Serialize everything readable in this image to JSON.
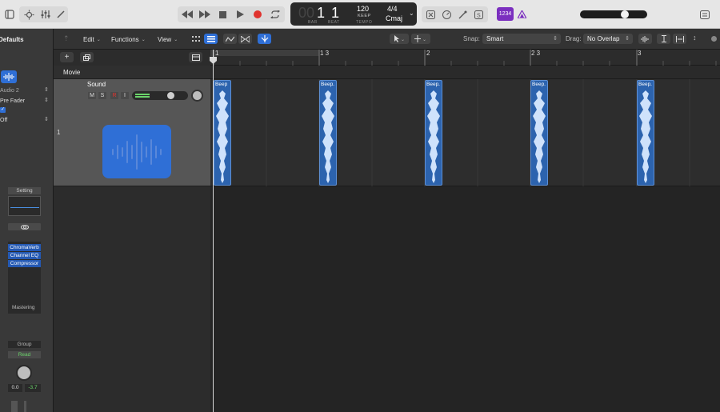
{
  "toolbar": {
    "lcd": {
      "bar": "1",
      "beat": "1",
      "bar_label": "BAR",
      "beat_label": "BEAT",
      "tempo": "120",
      "tempo_mode": "KEEP",
      "tempo_label": "TEMPO",
      "signature": "4/4",
      "key": "Cmaj"
    },
    "counter_badge": "1234"
  },
  "inspector": {
    "title": "Defaults",
    "output": "Audio 2",
    "send_position": "Pre Fader",
    "automation_mode": "Off",
    "setting_label": "Setting",
    "plugins": [
      "ChromaVerb",
      "Channel EQ",
      "Compressor"
    ],
    "mastering_label": "Mastering",
    "group_label": "Group",
    "read_label": "Read",
    "pan_value": "0.0",
    "volume_value": "-3.7"
  },
  "trackbar": {
    "edit_label": "Edit",
    "functions_label": "Functions",
    "view_label": "View",
    "snap_label": "Snap:",
    "snap_value": "Smart",
    "drag_label": "Drag:",
    "drag_value": "No Overlap"
  },
  "tracks": {
    "movie_label": "Movie",
    "track1": {
      "number": "1",
      "name": "Sound",
      "mute": "M",
      "solo": "S",
      "record": "R",
      "input": "I"
    }
  },
  "ruler": {
    "labels": [
      "1",
      "1 3",
      "2",
      "2 3",
      "3"
    ]
  },
  "regions": [
    "Beep",
    "Beep.",
    "Beep.",
    "Beep.",
    "Beep."
  ],
  "colors": {
    "region_fill": "#2c63ae",
    "region_wave": "#cfe2fb",
    "selection_blue": "#2f6fd6",
    "lcd_bg": "#2a2a2a",
    "record_red": "#e0332e",
    "badge_purple": "#7b2fbf"
  }
}
